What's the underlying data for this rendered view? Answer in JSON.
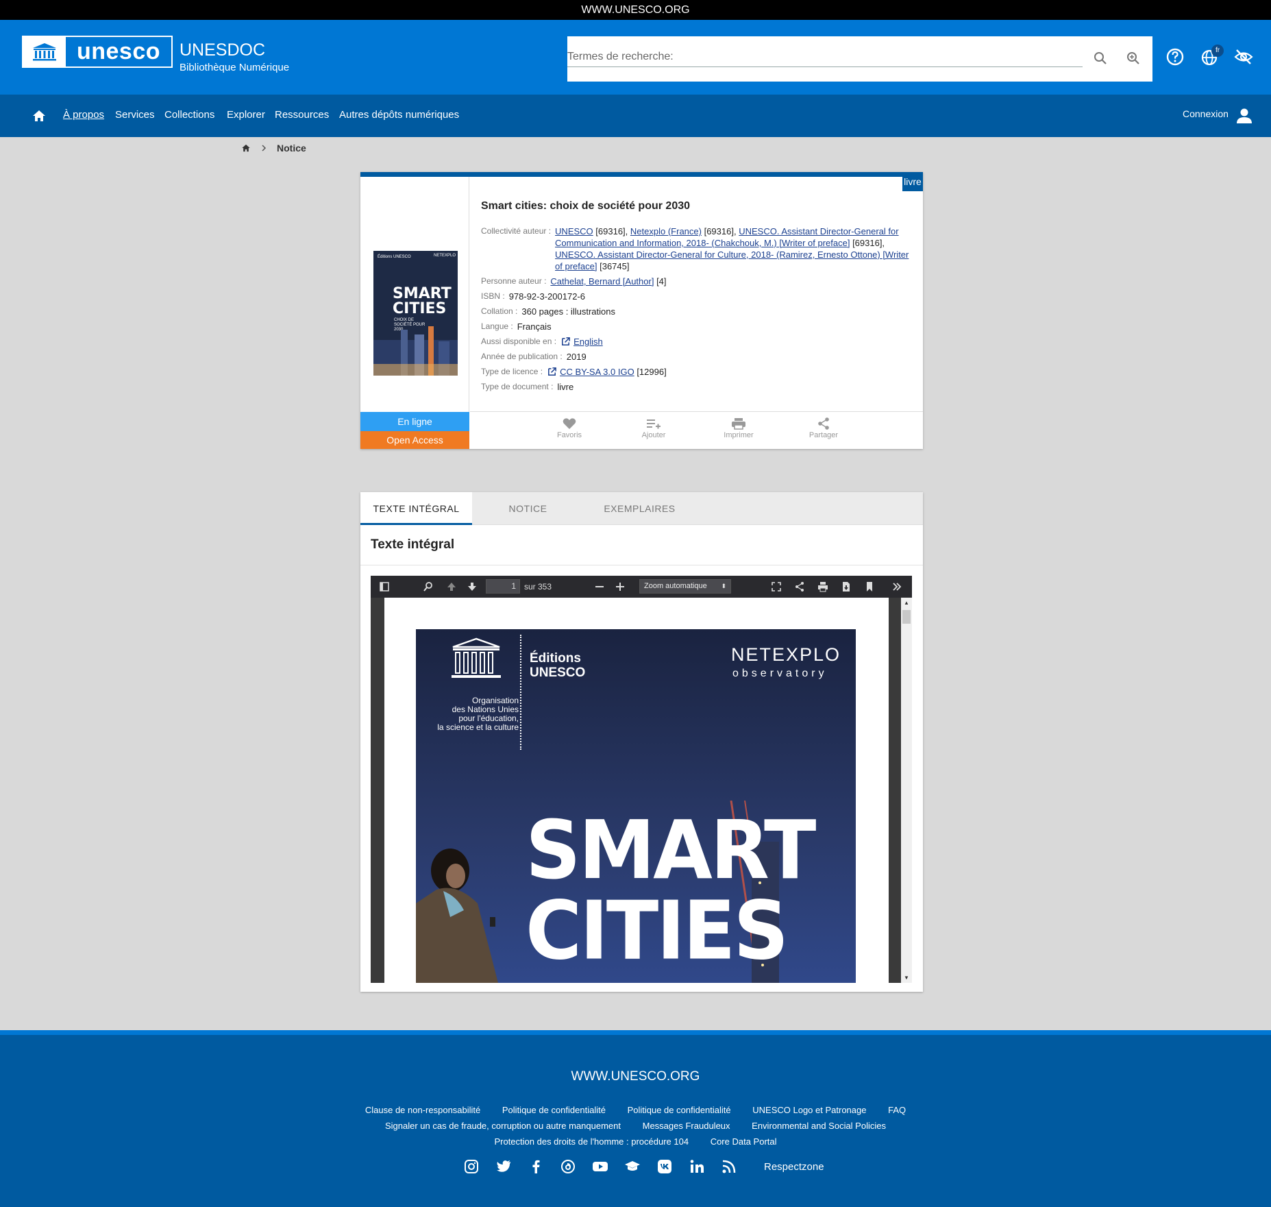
{
  "top_strip": {
    "text": "WWW.UNESCO.ORG"
  },
  "header": {
    "logo_word": "unesco",
    "title": "UNESDOC",
    "subtitle": "Bibliothèque Numérique",
    "search_placeholder": "Termes de recherche:",
    "language_badge": "fr",
    "colors": {
      "header_bg": "#0077d4",
      "nav_bg": "#005aa0"
    }
  },
  "nav": {
    "items": [
      "À propos",
      "Services",
      "Collections",
      "Explorer",
      "Ressources",
      "Autres dépôts numériques"
    ],
    "login": "Connexion"
  },
  "breadcrumb": {
    "current": "Notice"
  },
  "record": {
    "type_badge": "livre",
    "title": "Smart cities: choix de société pour 2030",
    "cover": {
      "title_line1": "SMART",
      "title_line2": "CITIES",
      "subtitle": "CHOIX DE SOCIÉTÉ POUR 2030",
      "publisher": "Éditions UNESCO",
      "partner": "NETEXPLO"
    },
    "fields": {
      "collectivite_label": "Collectivité auteur :",
      "collectivite_1": "UNESCO",
      "collectivite_1_id": "[69316],",
      "collectivite_2": "Netexplo (France)",
      "collectivite_2_id": "[69316],",
      "collectivite_3": "UNESCO. Assistant Director-General for Communication and Information, 2018- (Chakchouk, M.) [Writer of preface]",
      "collectivite_3_id": "[69316],",
      "collectivite_4": "UNESCO. Assistant Director-General for Culture, 2018- (Ramirez, Ernesto Ottone) [Writer of preface]",
      "collectivite_4_id": "[36745]",
      "personne_label": "Personne auteur :",
      "personne": "Cathelat, Bernard [Author]",
      "personne_id": "[4]",
      "isbn_label": "ISBN :",
      "isbn": "978-92-3-200172-6",
      "collation_label": "Collation :",
      "collation": "360 pages : illustrations",
      "langue_label": "Langue :",
      "langue": "Français",
      "aussi_label": "Aussi disponible en :",
      "aussi": "English",
      "annee_label": "Année de publication :",
      "annee": "2019",
      "licence_label": "Type de licence :",
      "licence": "CC BY-SA 3.0 IGO",
      "licence_id": "[12996]",
      "doctype_label": "Type de document :",
      "doctype": "livre"
    },
    "badges": {
      "online": "En ligne",
      "open_access": "Open Access",
      "online_color": "#2e9ff3",
      "oa_color": "#f07a22"
    },
    "actions": [
      "Favoris",
      "Ajouter",
      "Imprimer",
      "Partager"
    ]
  },
  "fulltext": {
    "tabs": [
      "TEXTE INTÉGRAL",
      "NOTICE",
      "EXEMPLAIRES"
    ],
    "active_tab": 0,
    "section_title": "Texte intégral",
    "viewer": {
      "page_number": "1",
      "page_total": "sur 353",
      "zoom": "Zoom automatique",
      "cover": {
        "editions_line1": "Éditions",
        "editions_line2": "UNESCO",
        "netexplo": "NETEXPLO",
        "observatory": "observatory",
        "org_line1": "Organisation",
        "org_line2": "des Nations Unies",
        "org_line3": "pour l'éducation,",
        "org_line4": "la science et la culture",
        "big_line1": "SMART",
        "big_line2": "CITIES"
      }
    }
  },
  "footer": {
    "site": "WWW.UNESCO.ORG",
    "links_row1": [
      "Clause de non-responsabilité",
      "Politique de confidentialité",
      "Politique de confidentialité",
      "UNESCO Logo et Patronage",
      "FAQ"
    ],
    "links_row2": [
      "Signaler un cas de fraude, corruption ou autre manquement",
      "Messages Frauduleux",
      "Environmental and Social Policies"
    ],
    "links_row3": [
      "Protection des droits de l'homme : procédure 104",
      "Core Data Portal"
    ],
    "social_icons": [
      "instagram-icon",
      "twitter-icon",
      "facebook-icon",
      "threads-icon",
      "youtube-icon",
      "graduation-cap-icon",
      "vk-icon",
      "linkedin-icon",
      "rss-icon"
    ],
    "respectzone": "Respectzone"
  }
}
